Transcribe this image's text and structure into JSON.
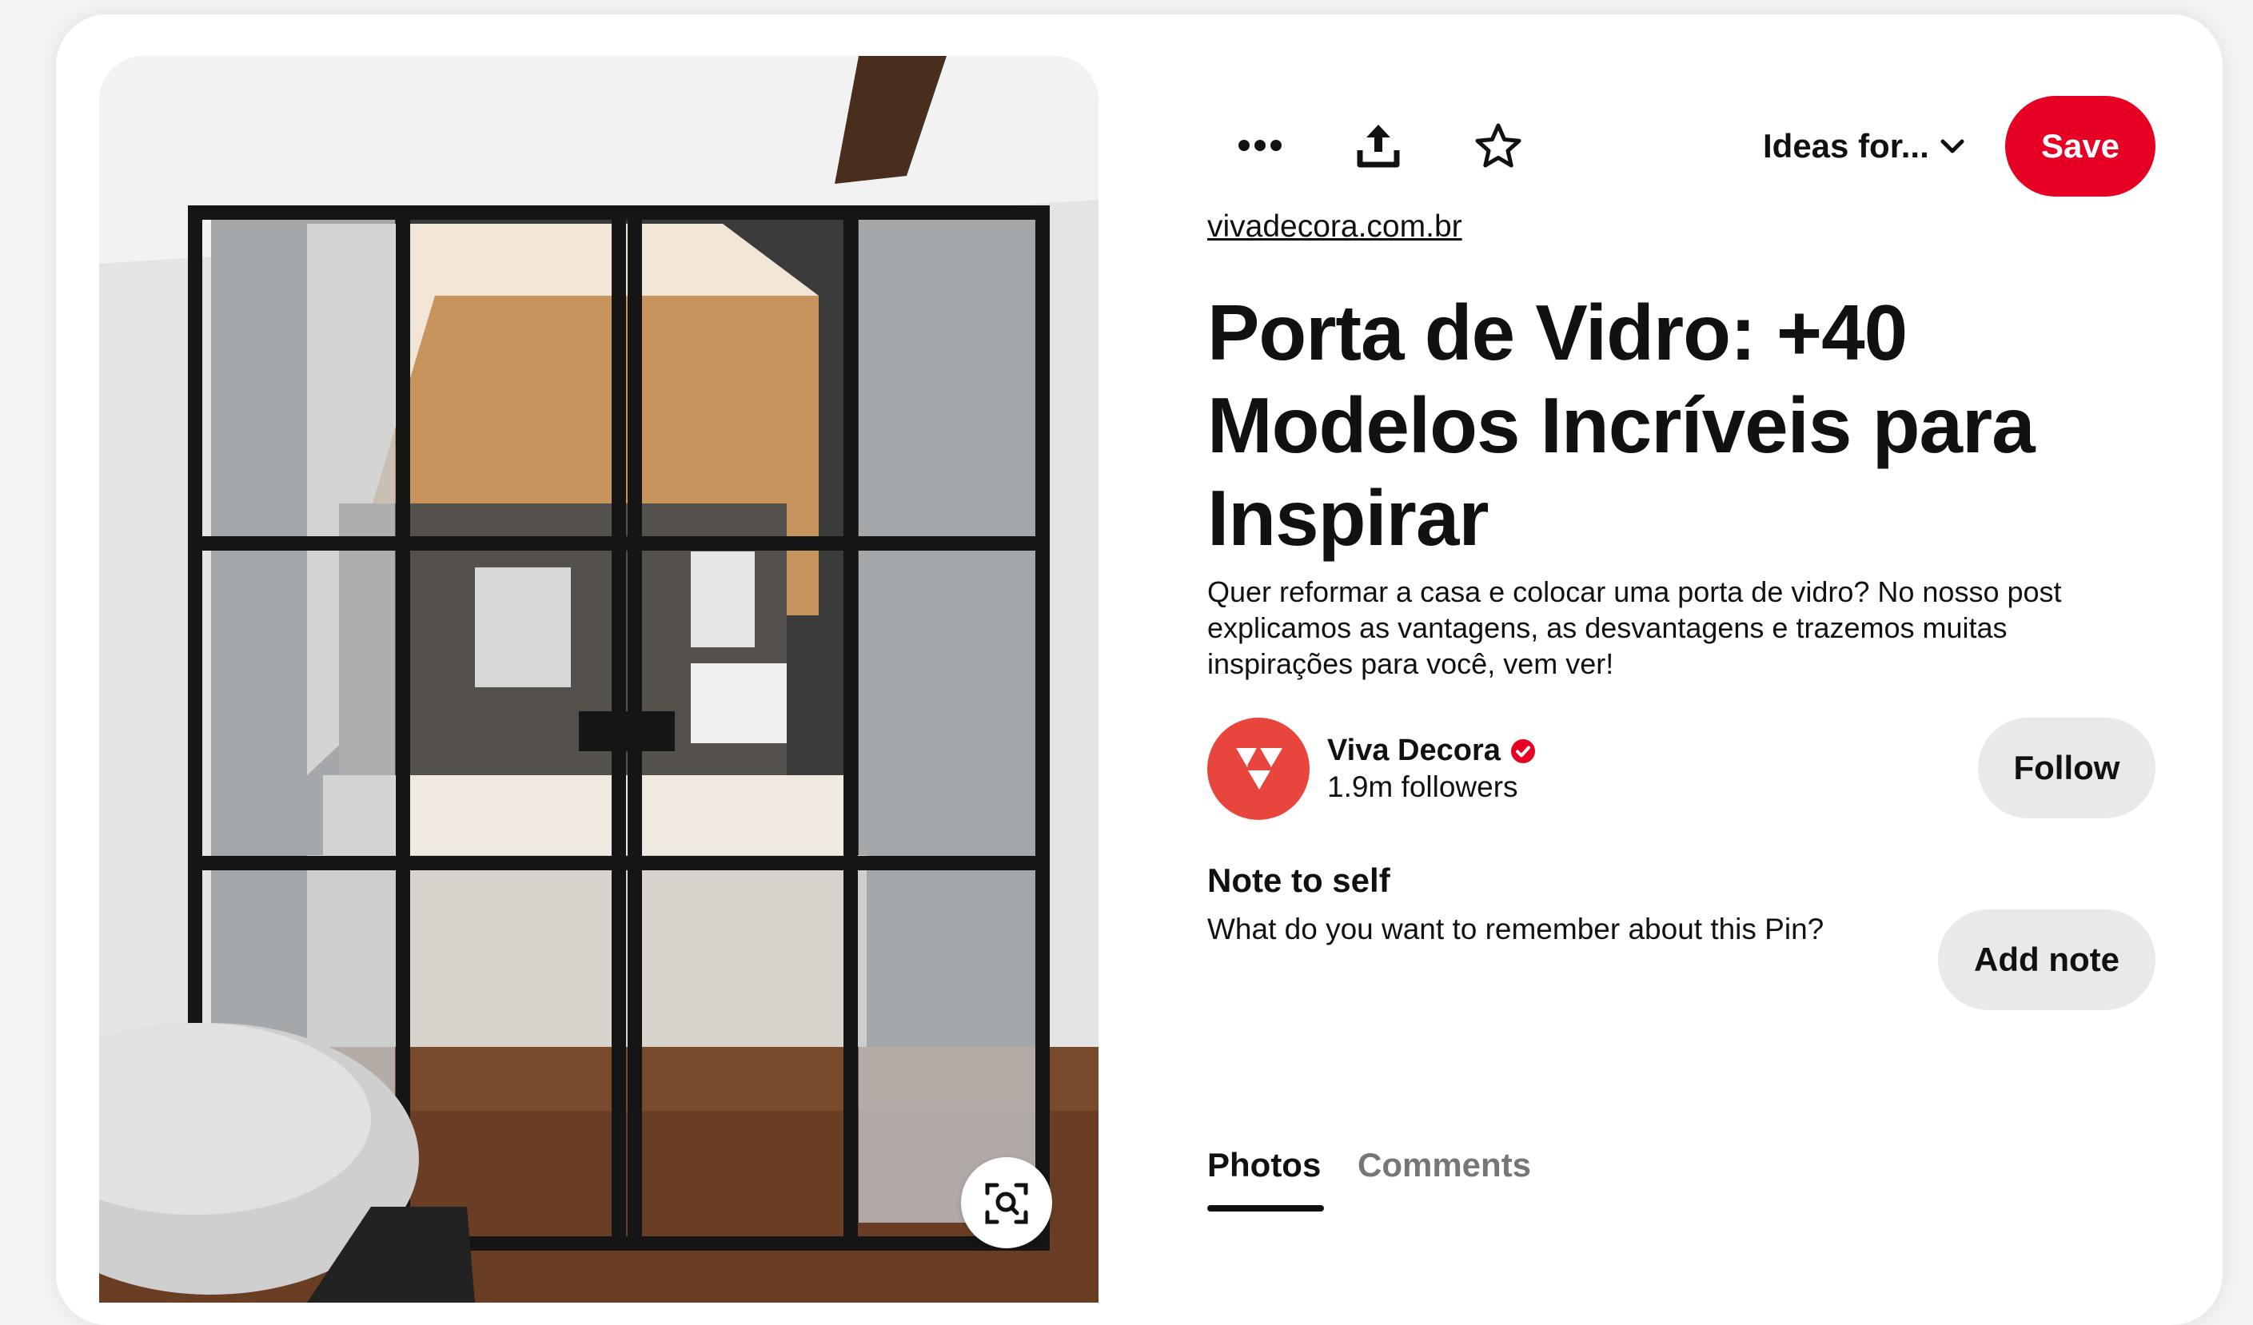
{
  "toolbar": {
    "more_icon": "more-options-icon",
    "share_icon": "share-upload-icon",
    "favorite_icon": "star-icon",
    "board_select_label": "Ideas for...",
    "save_label": "Save"
  },
  "pin": {
    "source": "vivadecora.com.br",
    "title": "Porta de Vidro: +40 Modelos Incríveis para Inspirar",
    "description": "Quer reformar a casa e colocar uma porta de vidro? No nosso post explicamos as vantagens, as desvantagens e trazemos muitas inspirações para você, vem ver!"
  },
  "creator": {
    "name": "Viva Decora",
    "followers": "1.9m followers",
    "verified": true,
    "follow_label": "Follow"
  },
  "note": {
    "heading": "Note to self",
    "prompt": "What do you want to remember about this Pin?",
    "add_label": "Add note"
  },
  "tabs": [
    {
      "label": "Photos",
      "active": true
    },
    {
      "label": "Comments",
      "active": false
    }
  ],
  "colors": {
    "brand_red": "#e60023",
    "avatar_red": "#e8463d",
    "button_gray": "#e9e9e9"
  }
}
